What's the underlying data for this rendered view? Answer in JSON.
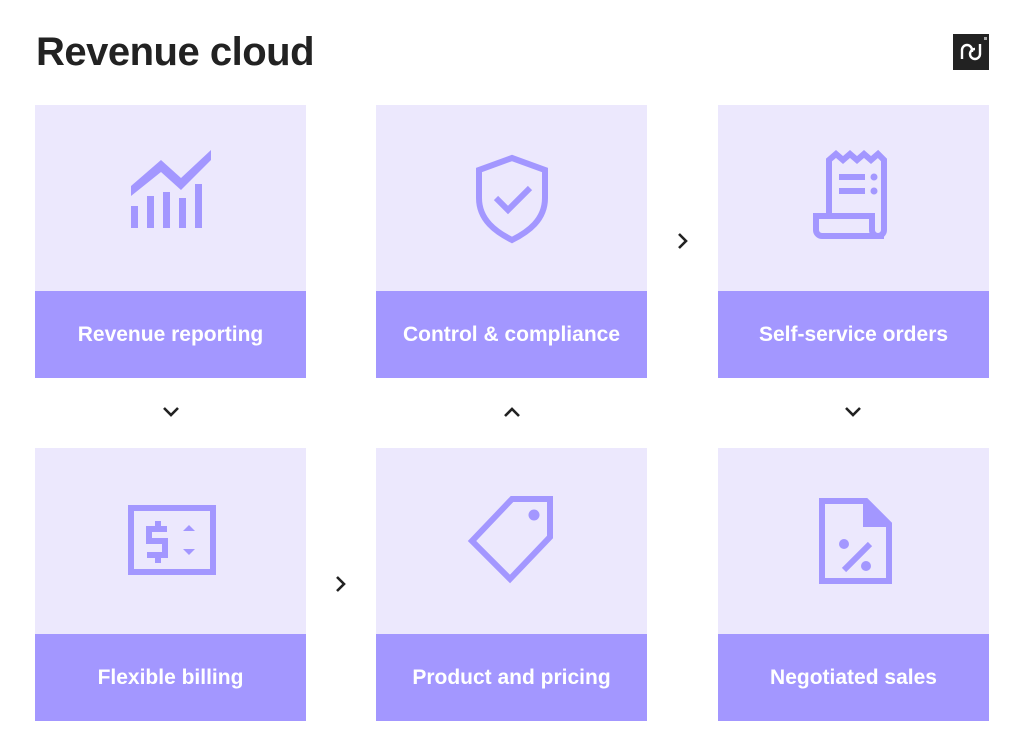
{
  "title": "Revenue cloud",
  "logo": {
    "name": "pd-logo-icon",
    "text": "pd"
  },
  "colors": {
    "card_bg": "#ece8fd",
    "accent": "#a397ff",
    "text": "#222222"
  },
  "cards": [
    {
      "label": "Revenue reporting",
      "icon": "chart-growth-icon"
    },
    {
      "label": "Control & compliance",
      "icon": "shield-check-icon"
    },
    {
      "label": "Self-service orders",
      "icon": "receipt-icon"
    },
    {
      "label": "Flexible billing",
      "icon": "dollar-bill-icon"
    },
    {
      "label": "Product and pricing",
      "icon": "price-tag-icon"
    },
    {
      "label": "Negotiated sales",
      "icon": "document-percent-icon"
    }
  ],
  "arrows": [
    {
      "from": "Revenue reporting",
      "to": "Flexible billing",
      "direction": "down"
    },
    {
      "from": "Flexible billing",
      "to": "Product and pricing",
      "direction": "right"
    },
    {
      "from": "Product and pricing",
      "to": "Control & compliance",
      "direction": "up"
    },
    {
      "from": "Control & compliance",
      "to": "Self-service orders",
      "direction": "right"
    },
    {
      "from": "Self-service orders",
      "to": "Negotiated sales",
      "direction": "down"
    }
  ]
}
